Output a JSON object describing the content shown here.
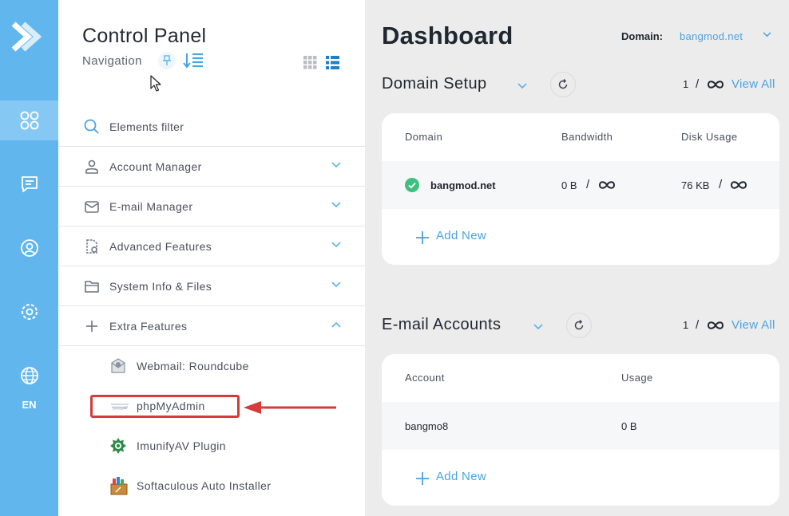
{
  "rail": {
    "lang": "EN"
  },
  "nav": {
    "title": "Control Panel",
    "subtitle": "Navigation",
    "filter_label": "Elements filter",
    "sections": [
      {
        "label": "Account Manager",
        "icon": "user-icon",
        "expanded": false
      },
      {
        "label": "E-mail Manager",
        "icon": "envelope-icon",
        "expanded": false
      },
      {
        "label": "Advanced Features",
        "icon": "advanced-doc-icon",
        "expanded": false
      },
      {
        "label": "System Info & Files",
        "icon": "folder-icon",
        "expanded": false
      },
      {
        "label": "Extra Features",
        "icon": "plus-icon",
        "expanded": true
      }
    ],
    "extra_items": [
      {
        "label": "Webmail: Roundcube",
        "icon": "roundcube-icon"
      },
      {
        "label": "phpMyAdmin",
        "icon": "phpmyadmin-icon"
      },
      {
        "label": "ImunifyAV Plugin",
        "icon": "imunify-icon"
      },
      {
        "label": "Softaculous Auto Installer",
        "icon": "softaculous-icon"
      }
    ]
  },
  "main": {
    "title": "Dashboard",
    "domain_label": "Domain:",
    "domain_value": "bangmod.net",
    "domain_setup": {
      "title": "Domain Setup",
      "count": "1",
      "slash": "/",
      "view_all": "View All",
      "headers": [
        "Domain",
        "Bandwidth",
        "Disk Usage"
      ],
      "row": {
        "domain": "bangmod.net",
        "bandwidth": "0 B",
        "disk": "76 KB",
        "slash": "/"
      },
      "add_new": "Add New"
    },
    "email_accounts": {
      "title": "E-mail Accounts",
      "count": "1",
      "slash": "/",
      "view_all": "View All",
      "headers": [
        "Account",
        "Usage"
      ],
      "row": {
        "account": "bangmo8",
        "usage": "0 B"
      },
      "add_new": "Add New"
    }
  },
  "colors": {
    "rail": "#61b6ee",
    "accent": "#4aa3e0",
    "highlight": "#d63a3a",
    "success": "#3fbf7f"
  }
}
